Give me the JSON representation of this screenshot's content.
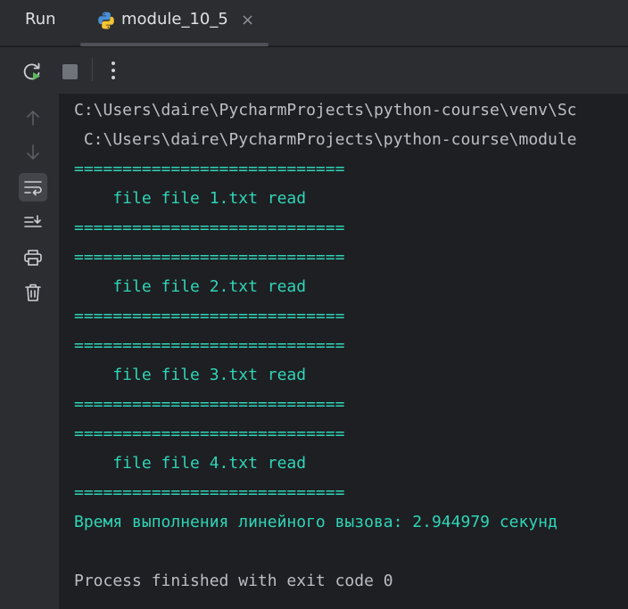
{
  "header": {
    "title": "Run",
    "tab": {
      "label": "module_10_5",
      "close": "×"
    }
  },
  "toolbar": {
    "rerun_icon": "rerun-icon",
    "stop_icon": "stop-icon",
    "more_icon": "more-vertical-icon"
  },
  "gutter": {
    "items": [
      "arrow-up-icon",
      "arrow-down-icon",
      "soft-wrap-icon",
      "scroll-to-end-icon",
      "print-icon",
      "trash-icon"
    ]
  },
  "console": {
    "lines": [
      {
        "text": "C:\\Users\\daire\\PycharmProjects\\python-course\\venv\\Sc",
        "kind": "path"
      },
      {
        "text": " C:\\Users\\daire\\PycharmProjects\\python-course\\module",
        "kind": "path"
      },
      {
        "text": "============================",
        "kind": "out"
      },
      {
        "text": "    file file 1.txt read",
        "kind": "out"
      },
      {
        "text": "============================",
        "kind": "out"
      },
      {
        "text": "============================",
        "kind": "out"
      },
      {
        "text": "    file file 2.txt read",
        "kind": "out"
      },
      {
        "text": "============================",
        "kind": "out"
      },
      {
        "text": "============================",
        "kind": "out"
      },
      {
        "text": "    file file 3.txt read",
        "kind": "out"
      },
      {
        "text": "============================",
        "kind": "out"
      },
      {
        "text": "============================",
        "kind": "out"
      },
      {
        "text": "    file file 4.txt read",
        "kind": "out"
      },
      {
        "text": "============================",
        "kind": "out"
      },
      {
        "text": "Время выполнения линейного вызова: 2.944979 секунд",
        "kind": "out"
      },
      {
        "text": "",
        "kind": "blank"
      },
      {
        "text": "Process finished with exit code 0",
        "kind": "path"
      }
    ]
  },
  "colors": {
    "path_text": "#bcbec4",
    "output_text": "#2fd5b8",
    "background": "#1e1f22",
    "panel": "#2b2d30"
  }
}
